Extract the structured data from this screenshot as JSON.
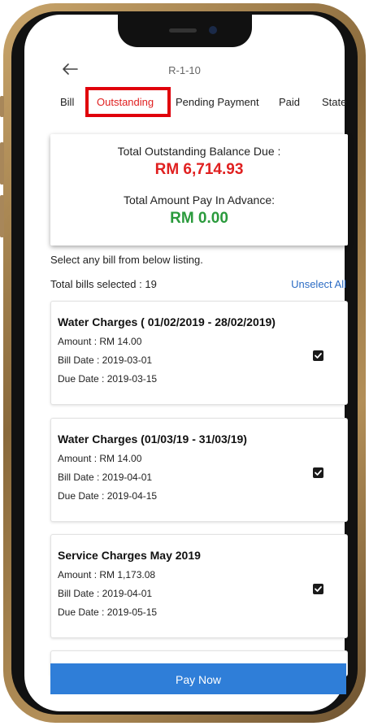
{
  "header": {
    "title": "R-1-10"
  },
  "tabs": [
    {
      "label": "Bill"
    },
    {
      "label": "Outstanding"
    },
    {
      "label": "Pending Payment"
    },
    {
      "label": "Paid"
    },
    {
      "label": "Statement"
    }
  ],
  "summary": {
    "outstanding_label": "Total Outstanding Balance Due :",
    "outstanding_amount": "RM 6,714.93",
    "advance_label": "Total Amount Pay In Advance:",
    "advance_amount": "RM 0.00",
    "outstanding_color": "#e02020",
    "advance_color": "#2a9a3c"
  },
  "listing": {
    "instruction": "Select any bill from below listing.",
    "total_selected": "Total bills selected : 19",
    "unselect_all": "Unselect All"
  },
  "bills": [
    {
      "title": "Water Charges ( 01/02/2019 - 28/02/2019)",
      "amount": "Amount : RM 14.00",
      "bill_date": "Bill Date : 2019-03-01",
      "due_date": "Due Date : 2019-03-15",
      "checked": true
    },
    {
      "title": "Water Charges (01/03/19 - 31/03/19)",
      "amount": "Amount : RM 14.00",
      "bill_date": "Bill Date : 2019-04-01",
      "due_date": "Due Date : 2019-04-15",
      "checked": true
    },
    {
      "title": "Service Charges May 2019",
      "amount": "Amount : RM 1,173.08",
      "bill_date": "Bill Date : 2019-04-01",
      "due_date": "Due Date : 2019-05-15",
      "checked": true
    }
  ],
  "footer": {
    "pay_label": "Pay Now",
    "pay_color": "#2f7ed8"
  },
  "icons": {
    "back": "arrow-left-icon",
    "check": "checkbox-checked-icon"
  }
}
